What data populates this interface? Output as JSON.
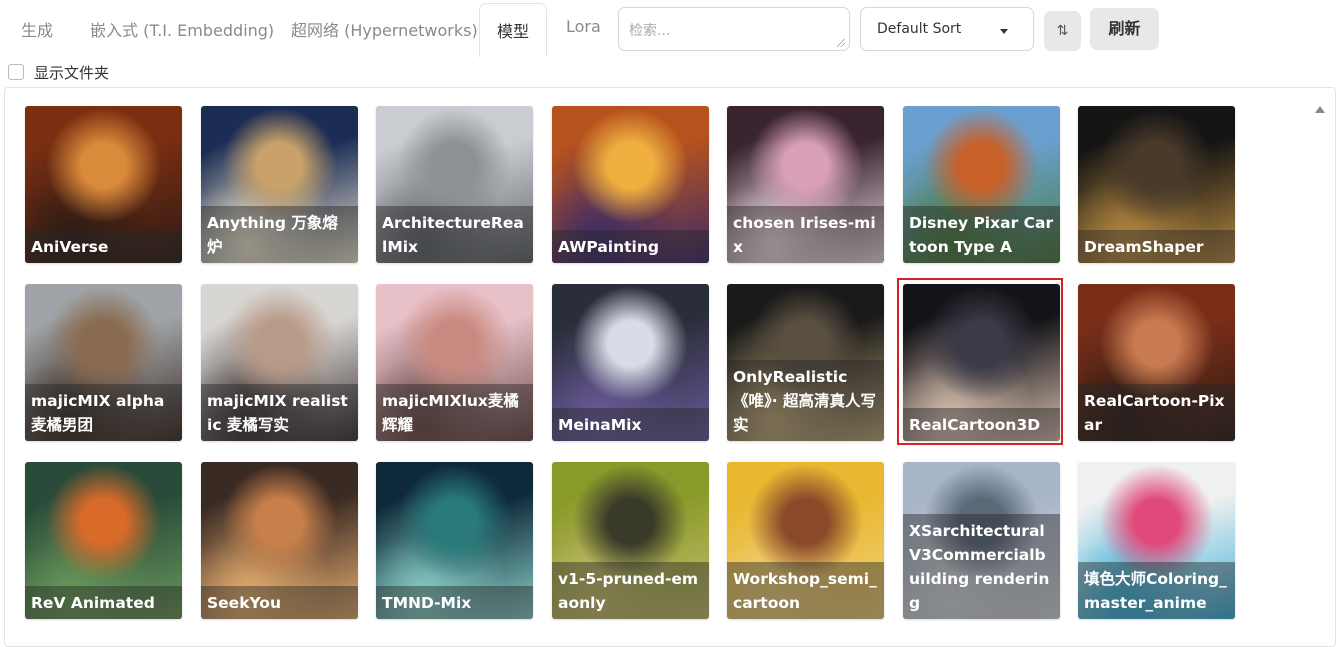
{
  "tabs": [
    {
      "label": "生成",
      "active": false
    },
    {
      "label": "嵌入式 (T.I. Embedding)",
      "active": false
    },
    {
      "label": "超网络 (Hypernetworks)",
      "active": false
    },
    {
      "label": "模型",
      "active": true
    },
    {
      "label": "Lora",
      "active": false
    }
  ],
  "search": {
    "placeholder": "检索..."
  },
  "sort": {
    "selected": "Default Sort"
  },
  "sort_direction_glyph": "⇅",
  "refresh_label": "刷新",
  "show_dirs_label": "显示文件夹",
  "selected_card": "RealCartoon3D",
  "highlight_color": "#d52222",
  "cards": [
    {
      "label": "AniVerse",
      "colors": [
        "#7a2e12",
        "#d98a3a",
        "#2a1a14"
      ],
      "icon": "anime-girl-orange-hair"
    },
    {
      "label": "Anything 万象熔炉",
      "colors": [
        "#1c2d55",
        "#c8a26a",
        "#f0e8d0"
      ],
      "icon": "balloons-girl"
    },
    {
      "label": "ArchitectureRealMix",
      "colors": [
        "#c9ccd0",
        "#8d9196",
        "#5f6368"
      ],
      "icon": "skyscraper"
    },
    {
      "label": "AWPainting",
      "colors": [
        "#b5521e",
        "#f0b040",
        "#3a2a6a"
      ],
      "icon": "anime-girl-flowers"
    },
    {
      "label": "chosen Irises-mix",
      "colors": [
        "#3a2430",
        "#d9a0b8",
        "#f0e0e8"
      ],
      "icon": "anime-girl-white-hair"
    },
    {
      "label": "Disney Pixar Cartoon Type A",
      "colors": [
        "#6aa0d0",
        "#c8602a",
        "#4a7a3a"
      ],
      "icon": "cartoon-girl-hat"
    },
    {
      "label": "DreamShaper",
      "colors": [
        "#141414",
        "#4a3a2a",
        "#b88a40"
      ],
      "icon": "woman-butterfly"
    },
    {
      "label": "majicMIX alpha 麦橘男团",
      "colors": [
        "#a0a4a8",
        "#8a6a50",
        "#3a2a20"
      ],
      "icon": "man-portrait"
    },
    {
      "label": "majicMIX realistic 麦橘写实",
      "colors": [
        "#d8d6d2",
        "#b89a88",
        "#3a3030"
      ],
      "icon": "woman-portrait"
    },
    {
      "label": "majicMIXlux麦橘辉耀",
      "colors": [
        "#e8c0c8",
        "#c88a80",
        "#6a4a48"
      ],
      "icon": "woman-cherry-blossom"
    },
    {
      "label": "MeinaMix",
      "colors": [
        "#2a2e3a",
        "#d8dce6",
        "#6a5a9a"
      ],
      "icon": "anime-girl-silver-hair"
    },
    {
      "label": "OnlyRealistic 《唯》· 超高清真人写实",
      "colors": [
        "#1a1a1a",
        "#5a5040",
        "#c0a878"
      ],
      "icon": "bridge-night"
    },
    {
      "label": "RealCartoon3D",
      "colors": [
        "#141418",
        "#3a3a48",
        "#d8c0b0"
      ],
      "icon": "cartoon-girl-dark"
    },
    {
      "label": "RealCartoon-Pixar",
      "colors": [
        "#7a2e18",
        "#c87a50",
        "#2a1a14"
      ],
      "icon": "cartoon-girl-freckles"
    },
    {
      "label": "ReV Animated",
      "colors": [
        "#2a4a3a",
        "#d86a2a",
        "#6a9a5a"
      ],
      "icon": "torii-gate"
    },
    {
      "label": "SeekYou",
      "colors": [
        "#3a2a24",
        "#c8804a",
        "#e8b070"
      ],
      "icon": "woman-curly-hair"
    },
    {
      "label": "TMND-Mix",
      "colors": [
        "#0e2a3a",
        "#2a7a7a",
        "#8ad0c8"
      ],
      "icon": "underwater-figure"
    },
    {
      "label": "v1-5-pruned-emaonly",
      "colors": [
        "#8a9a2a",
        "#3a3a2a",
        "#c8c070"
      ],
      "icon": "black-cat"
    },
    {
      "label": "Workshop_semi_cartoon",
      "colors": [
        "#e8b830",
        "#8a4a2a",
        "#f0d080"
      ],
      "icon": "chibi-girl-crown"
    },
    {
      "label": "XSarchitecturalV3Commercialbuilding rendering",
      "colors": [
        "#a8b4c8",
        "#5a6878",
        "#d8dce0"
      ],
      "icon": "building-facade"
    },
    {
      "label": "填色大师Coloring_master_anime",
      "colors": [
        "#f0f0f0",
        "#e04a7a",
        "#3ab0d8"
      ],
      "icon": "colorful-anime-girl"
    }
  ]
}
